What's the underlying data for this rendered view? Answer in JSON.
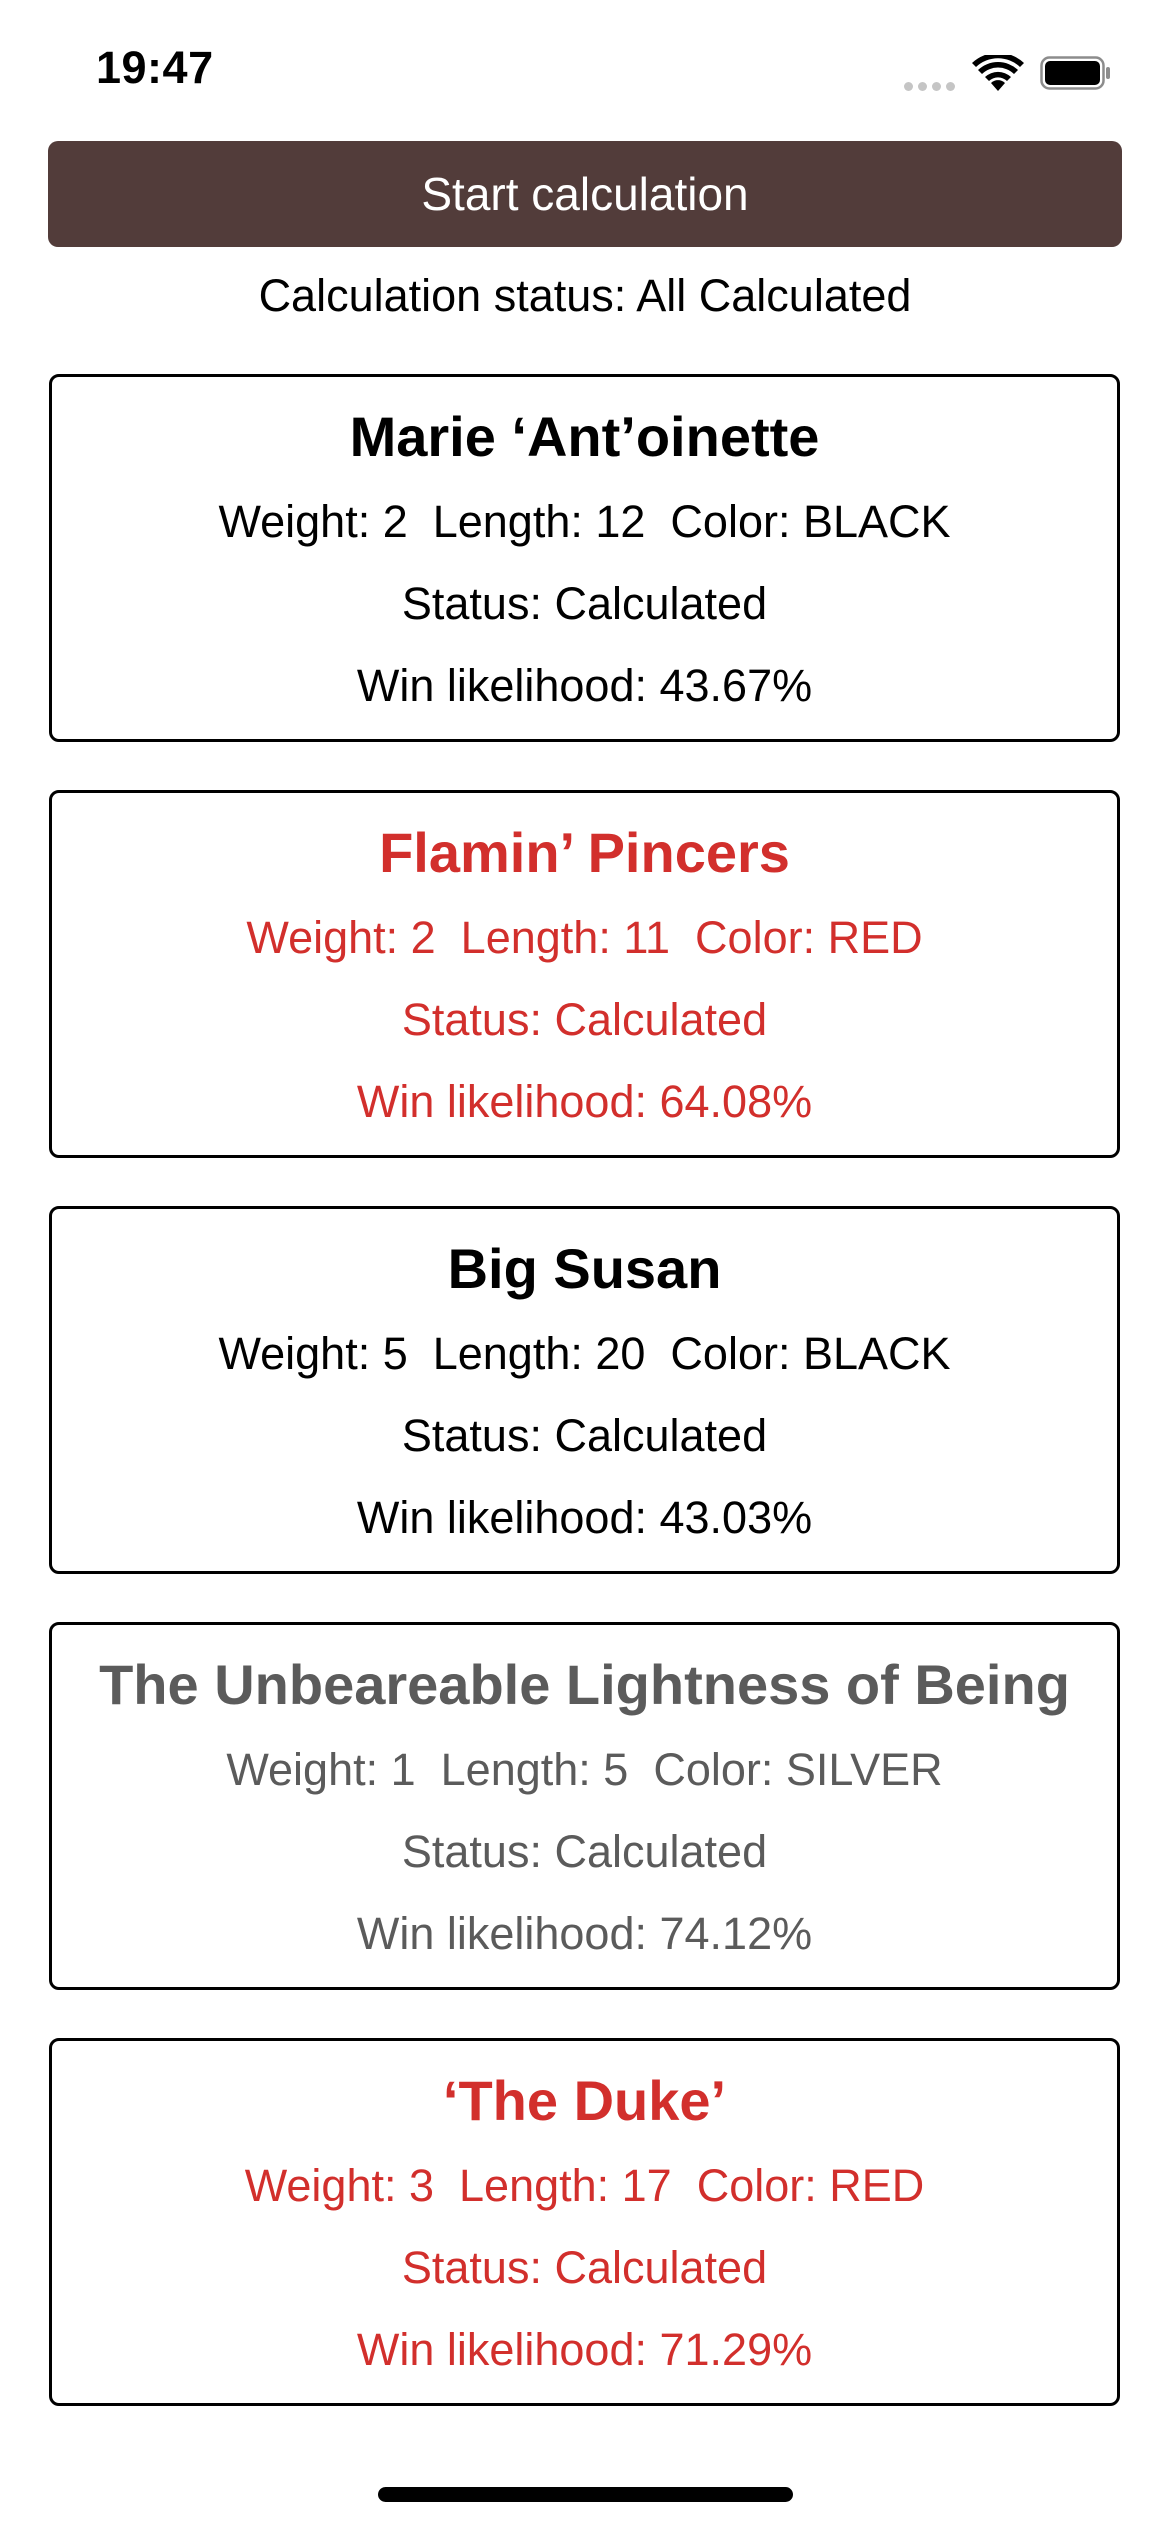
{
  "status_bar": {
    "time": "19:47",
    "icons": [
      "signal-icon",
      "wifi-icon",
      "battery-icon"
    ]
  },
  "start_button": {
    "label": "Start calculation",
    "background": "#523c3a"
  },
  "calculation_status": "Calculation status: All Calculated",
  "colors": {
    "black": "#000000",
    "red": "#d22f2c",
    "silver": "#5b5b5b"
  },
  "cards": [
    {
      "name": "Marie ‘Ant’oinette",
      "stats": "Weight: 2  Length: 12  Color: BLACK",
      "status": "Status: Calculated",
      "likelihood": "Win likelihood: 43.67%",
      "text_color": "black"
    },
    {
      "name": "Flamin’ Pincers",
      "stats": "Weight: 2  Length: 11  Color: RED",
      "status": "Status: Calculated",
      "likelihood": "Win likelihood: 64.08%",
      "text_color": "red"
    },
    {
      "name": "Big Susan",
      "stats": "Weight: 5  Length: 20  Color: BLACK",
      "status": "Status: Calculated",
      "likelihood": "Win likelihood: 43.03%",
      "text_color": "black"
    },
    {
      "name": "The Unbeareable Lightness of Being",
      "stats": "Weight: 1  Length: 5  Color: SILVER",
      "status": "Status: Calculated",
      "likelihood": "Win likelihood: 74.12%",
      "text_color": "silver"
    },
    {
      "name": "‘The Duke’",
      "stats": "Weight: 3  Length: 17  Color: RED",
      "status": "Status: Calculated",
      "likelihood": "Win likelihood: 71.29%",
      "text_color": "red"
    }
  ]
}
